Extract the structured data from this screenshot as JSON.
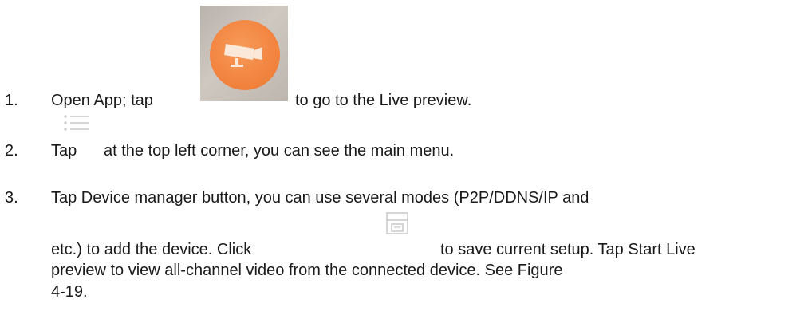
{
  "steps": [
    {
      "number": "1.",
      "text_before": "Open App; tap",
      "text_after": "to go to the Live preview."
    },
    {
      "number": "2.",
      "text_before": "Tap",
      "text_after": "at the top left corner, you can see the main menu."
    },
    {
      "number": "3.",
      "line1": "Tap Device manager button, you can use several modes (P2P/DDNS/IP and",
      "line2_before": "etc.) to add the device. Click",
      "line2_after": "to save current setup. Tap Start Live",
      "line3": "preview to view all-channel video from the connected device. See Figure",
      "line4": "4-19."
    }
  ],
  "icons": {
    "app_icon": "camera-app-icon",
    "menu_icon": "list-menu-icon",
    "save_icon": "save-floppy-icon"
  },
  "colors": {
    "app_icon_circle": "#f2843f",
    "icon_gray": "#c8c8c8",
    "text": "#1a1a1a"
  }
}
